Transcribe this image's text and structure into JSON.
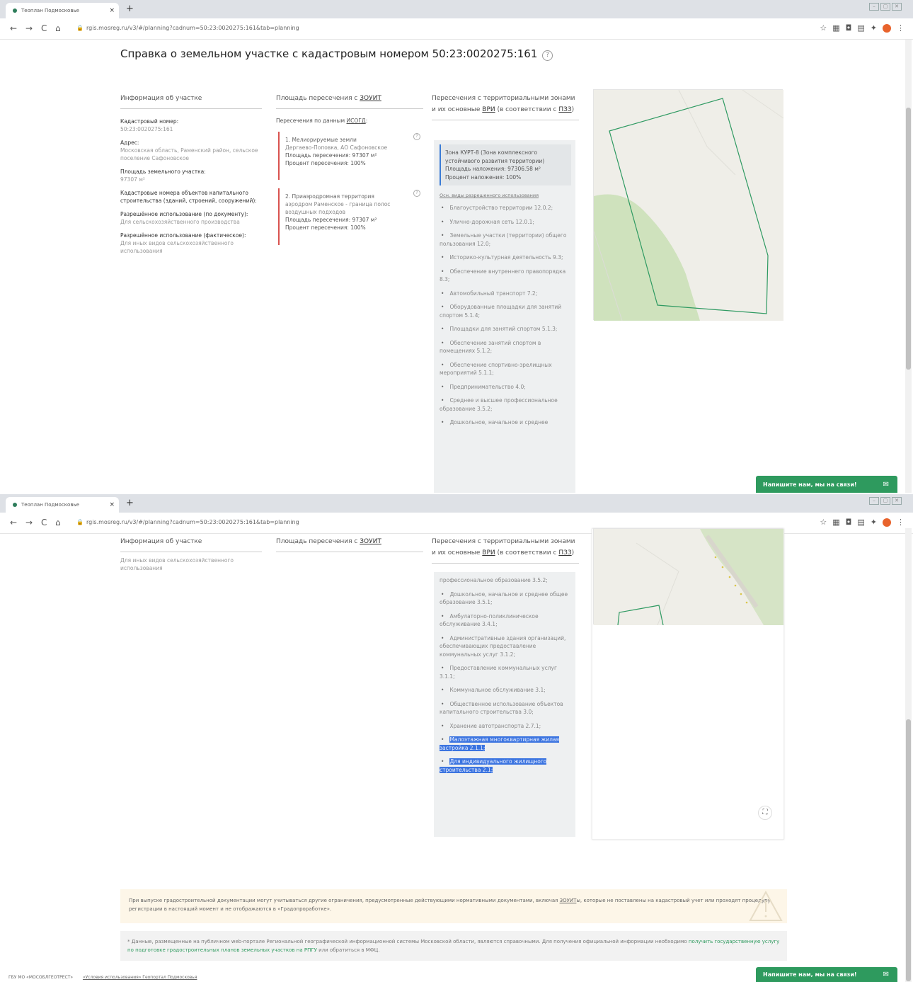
{
  "browser": {
    "tab_title": "Теоплан Подмосковье",
    "tab_close": "×",
    "new_tab": "+",
    "url": "rgis.mosreg.ru/v3/#/planning?cadnum=50:23:0020275:161&tab=planning",
    "nav_back": "←",
    "nav_forward": "→",
    "nav_reload": "C",
    "nav_home": "⌂"
  },
  "page": {
    "title": "Справка о земельном участке с кадастровым номером 50:23:0020275:161",
    "help": "?"
  },
  "columns": {
    "info": "Информация об участке",
    "area_prefix": "Площадь пересечения с ",
    "area_link": "ЗОУИТ",
    "zones_prefix": "Пересечения с территориальными зонами и их основные ",
    "zones_link1": "ВРИ",
    "zones_mid": " (в соответствии с ",
    "zones_link2": "ПЗЗ",
    "zones_suffix": ")"
  },
  "info": {
    "cad_label": "Кадастровый номер:",
    "cad_value": "50:23:0020275:161",
    "addr_label": "Адрес:",
    "addr_value": "Московская область, Раменский район, сельское поселение Сафоновское",
    "area_label": "Площадь земельного участка:",
    "area_value": "97307 м²",
    "oks_label": "Кадастровые номера объектов капитального строительства (зданий, строений, сооружений):",
    "use_doc_label": "Разрешённое использование (по документу):",
    "use_doc_value": "Для сельскохозяйственного производства",
    "use_fact_label": "Разрешённое использование (фактическое):",
    "use_fact_value": "Для иных видов сельскохозяйственного использования"
  },
  "isogd": {
    "prefix": "Пересечения по данным ",
    "link": "ИСОГД",
    "suffix": ":"
  },
  "zouit_cards": [
    {
      "title": "1. Мелиорируемые земли",
      "desc": "Дергаево-Поповка, АО Сафоновское",
      "area": "Площадь пересечения: 97307 м²",
      "pct": "Процент пересечения: 100%"
    },
    {
      "title": "2. Приаэродромная территория",
      "desc": "аэродром Раменское - граница полос воздушных подходов",
      "area": "Площадь пересечения: 97307 м²",
      "pct": "Процент пересечения: 100%"
    }
  ],
  "zone": {
    "name": "Зона КУРТ-8 (Зона комплексного устойчивого развития территории)",
    "area": "Площадь наложения: 97306.58 м²",
    "pct": "Процент наложения: 100%",
    "vri_link": "Осн. виды разрешенного использования"
  },
  "vri_top": [
    "Благоустройство территории 12.0.2;",
    "Улично-дорожная сеть 12.0.1;",
    "Земельные участки (территории) общего пользования 12.0;",
    "Историко-культурная деятельность 9.3;",
    "Обеспечение внутреннего правопорядка 8.3;",
    "Автомобильный транспорт 7.2;",
    "Оборудованные площадки для занятий спортом 5.1.4;",
    "Площадки для занятий спортом 5.1.3;",
    "Обеспечение занятий спортом в помещениях 5.1.2;",
    "Обеспечение спортивно-зрелищных мероприятий 5.1.1;",
    "Предпринимательство 4.0;",
    "Среднее и высшее профессиональное образование 3.5.2;",
    "Дошкольное, начальное и среднее"
  ],
  "vri_bottom_partial": "профессиональное образование 3.5.2;",
  "vri_bottom": [
    "Дошкольное, начальное и среднее общее образование 3.5.1;",
    "Амбулаторно-поликлиническое обслуживание 3.4.1;",
    "Административные здания организаций, обеспечивающих предоставление коммунальных услуг 3.1.2;",
    "Предоставление коммунальных услуг 3.1.1;",
    "Коммунальное обслуживание 3.1;",
    "Общественное использование объектов капитального строительства 3.0;",
    "Хранение автотранспорта 2.7.1;"
  ],
  "vri_selected": [
    "Малоэтажная многоквартирная жилая застройка 2.1.1;",
    "Для индивидуального жилищного строительства 2.1;"
  ],
  "chat": {
    "label": "Напишите нам, мы на связи!",
    "icon": "✉"
  },
  "expand_icon": "⛶",
  "warning": {
    "text1": "При выпуске градостроительной документации могут учитываться другие ограничения, предусмотренные действующими нормативными документами, включая ",
    "link": "ЗОУИТ",
    "text2": "ы, которые не поставлены на кадастровый учет или проходят процедуру регистрации в настоящий момент и не отображаются в «Градопроработке»."
  },
  "note": {
    "text1": "* Данные, размещенные на публичном web-портале Региональной географической информационной системы Московской области, являются справочными. Для получения официальной информации необходимо ",
    "link": "получить государственную услугу по подготовке градостроительных планов земельных участков на РПГУ",
    "text2": " или обратиться в МФЦ."
  },
  "footer": {
    "org": "ГБУ МО «МОСОБЛГЕОТРЕСТ»",
    "terms": "«Условия использования» Геопортал Подмосковья"
  },
  "colors": {
    "accent_green": "#2e9a5e",
    "alert_red": "#d9534f",
    "zone_blue": "#3a7bd5",
    "selection_blue": "#3b74e0"
  }
}
